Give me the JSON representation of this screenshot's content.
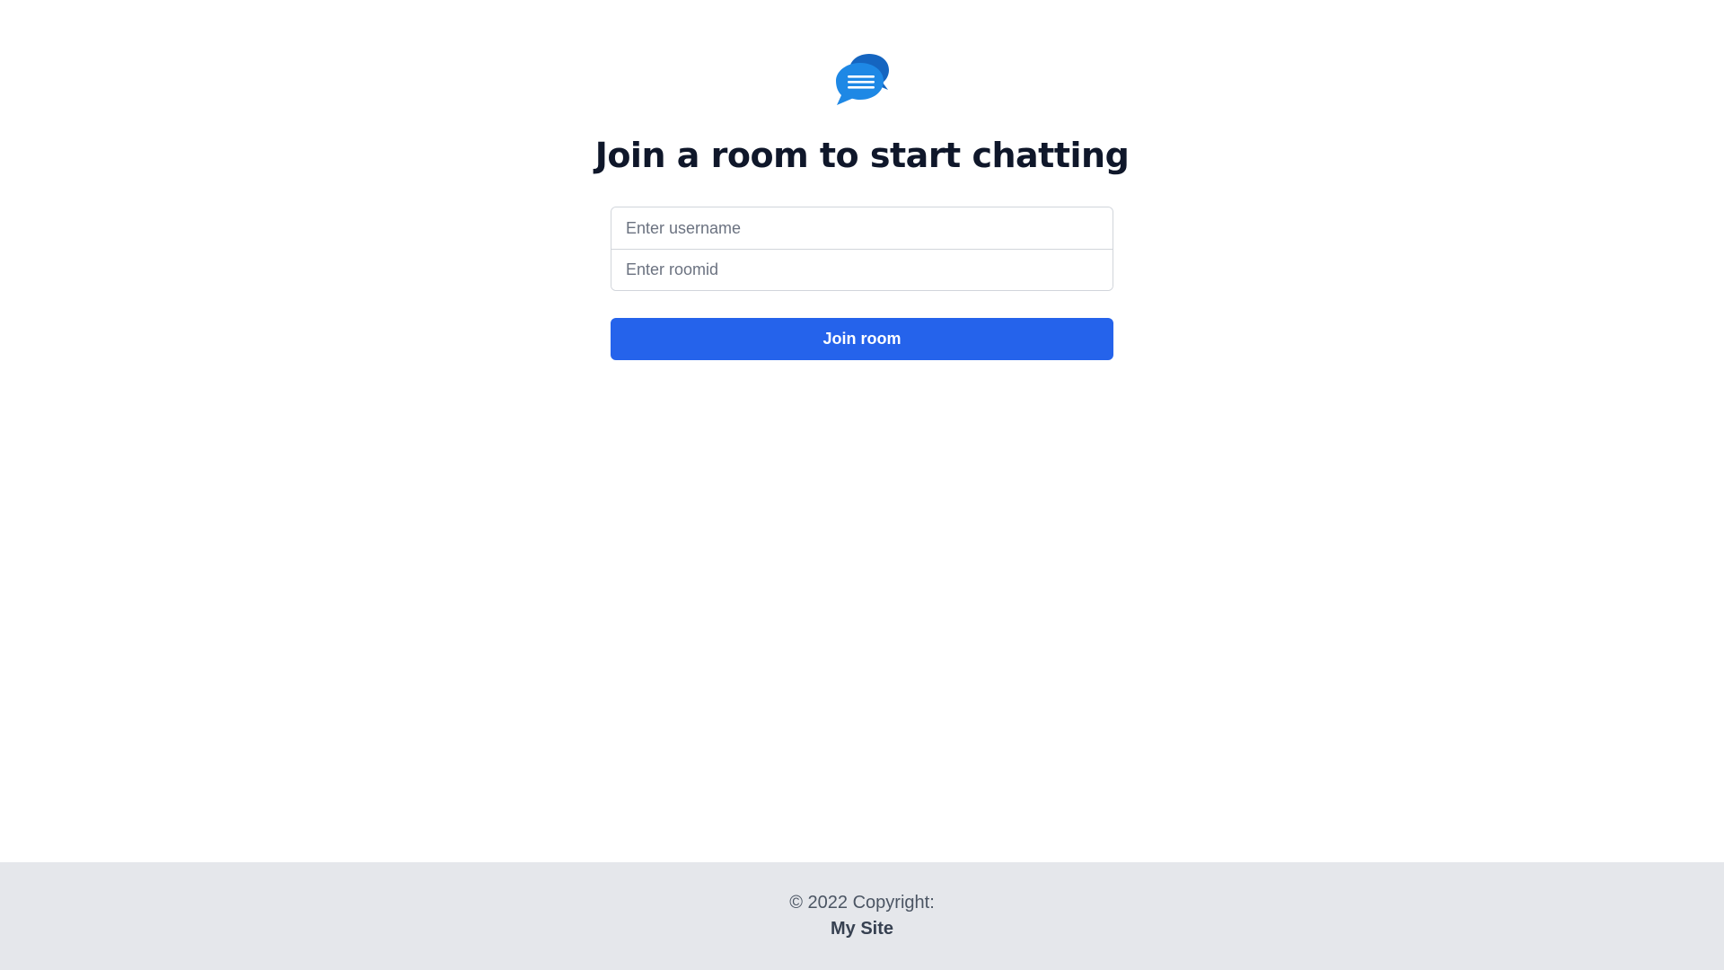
{
  "logo": {
    "icon": "chat-bubbles-icon",
    "color": "#1e88e5"
  },
  "heading": "Join a room to start chatting",
  "form": {
    "username_placeholder": "Enter username",
    "username_value": "",
    "roomid_placeholder": "Enter roomid",
    "roomid_value": "",
    "join_label": "Join room"
  },
  "footer": {
    "copyright": "© 2022 Copyright:",
    "site_link": "My Site"
  },
  "colors": {
    "accent": "#2563eb",
    "footer_bg": "#e5e7eb",
    "heading": "#0f172a"
  }
}
